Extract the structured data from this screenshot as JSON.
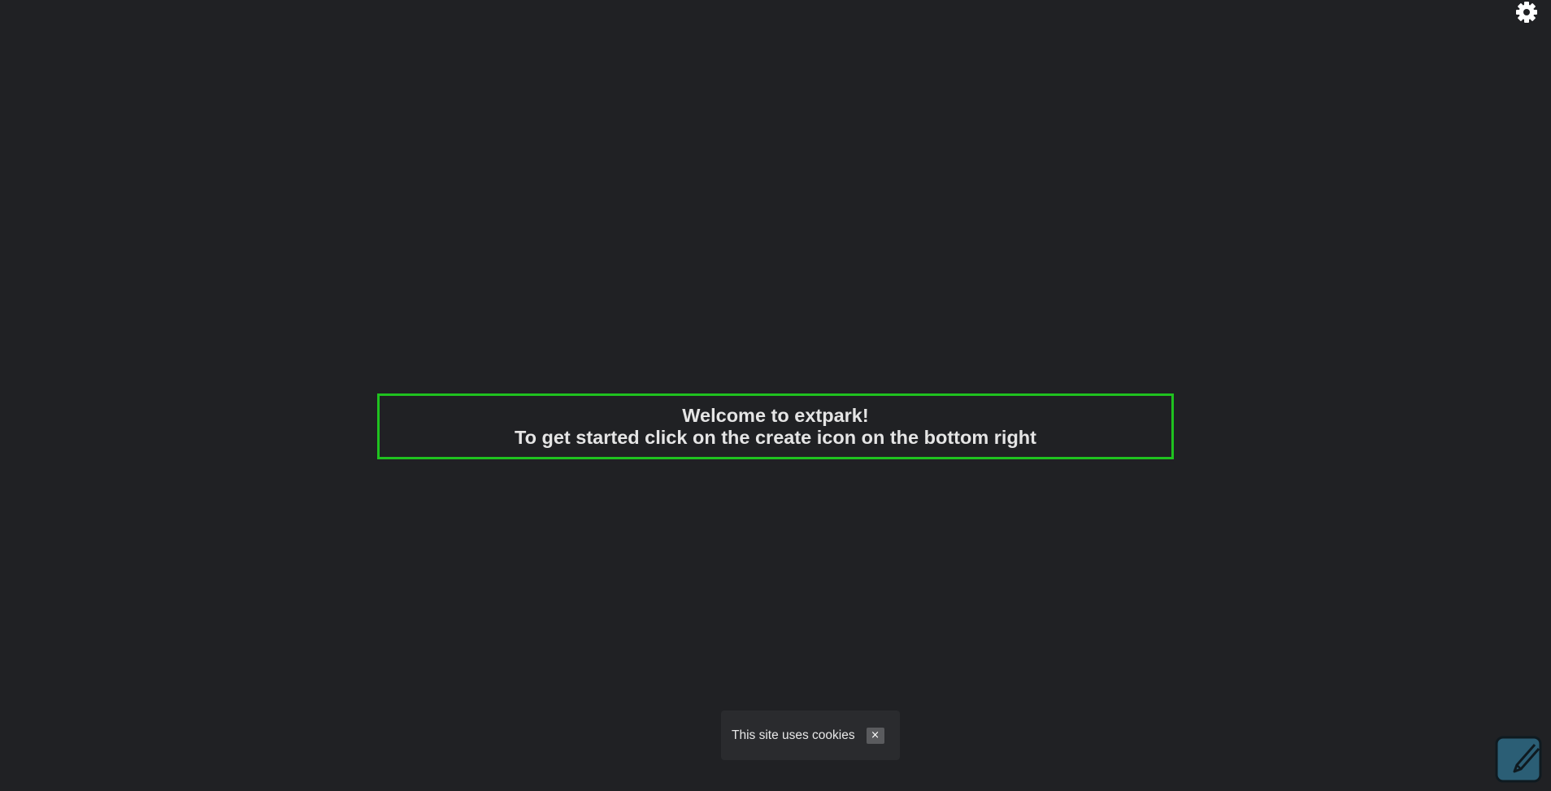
{
  "settings": {
    "icon": "gear-icon",
    "color": "#ffffff"
  },
  "welcome": {
    "line1": "Welcome to extpark!",
    "line2": "To get started click on the create icon on the bottom right",
    "border_color": "#1fc21f",
    "text_color": "#e5e5e5"
  },
  "cookie_banner": {
    "text": "This site uses cookies",
    "close_label": "×"
  },
  "create_button": {
    "icon": "edit-icon",
    "fill": "#2b5e75",
    "stroke": "#0f1a20"
  },
  "colors": {
    "background": "#202124"
  }
}
